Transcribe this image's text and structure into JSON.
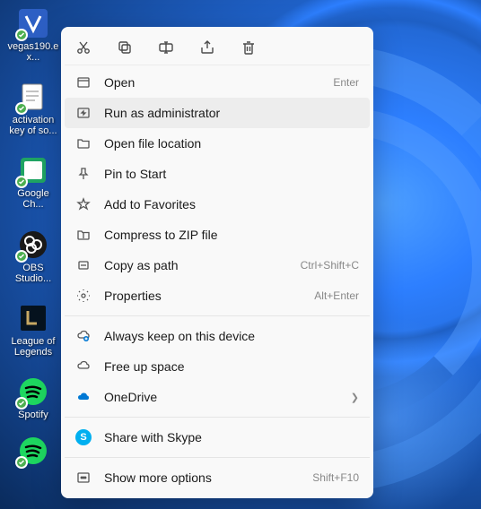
{
  "desktop": {
    "icons": [
      {
        "label": "vegas190.ex..."
      },
      {
        "label": "activation key of so..."
      },
      {
        "label": "Google Ch..."
      },
      {
        "label": "OBS Studio..."
      },
      {
        "label": "League of Legends"
      },
      {
        "label": "Spotify"
      }
    ]
  },
  "contextMenu": {
    "items": [
      {
        "label": "Open",
        "shortcut": "Enter"
      },
      {
        "label": "Run as administrator",
        "shortcut": ""
      },
      {
        "label": "Open file location",
        "shortcut": ""
      },
      {
        "label": "Pin to Start",
        "shortcut": ""
      },
      {
        "label": "Add to Favorites",
        "shortcut": ""
      },
      {
        "label": "Compress to ZIP file",
        "shortcut": ""
      },
      {
        "label": "Copy as path",
        "shortcut": "Ctrl+Shift+C"
      },
      {
        "label": "Properties",
        "shortcut": "Alt+Enter"
      },
      {
        "label": "Always keep on this device",
        "shortcut": ""
      },
      {
        "label": "Free up space",
        "shortcut": ""
      },
      {
        "label": "OneDrive",
        "shortcut": ""
      },
      {
        "label": "Share with Skype",
        "shortcut": ""
      },
      {
        "label": "Show more options",
        "shortcut": "Shift+F10"
      }
    ]
  }
}
